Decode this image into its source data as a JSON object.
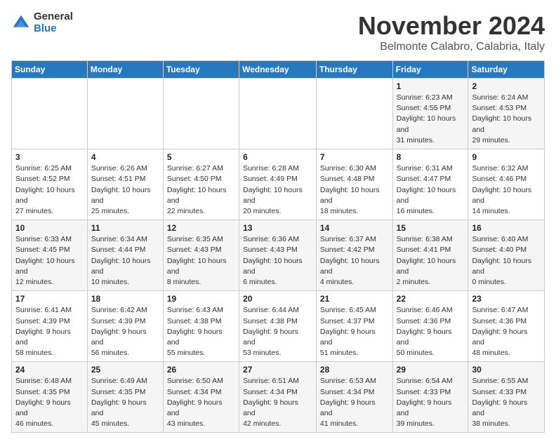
{
  "header": {
    "logo_general": "General",
    "logo_blue": "Blue",
    "month": "November 2024",
    "location": "Belmonte Calabro, Calabria, Italy"
  },
  "weekdays": [
    "Sunday",
    "Monday",
    "Tuesday",
    "Wednesday",
    "Thursday",
    "Friday",
    "Saturday"
  ],
  "weeks": [
    [
      {
        "day": "",
        "detail": ""
      },
      {
        "day": "",
        "detail": ""
      },
      {
        "day": "",
        "detail": ""
      },
      {
        "day": "",
        "detail": ""
      },
      {
        "day": "",
        "detail": ""
      },
      {
        "day": "1",
        "detail": "Sunrise: 6:23 AM\nSunset: 4:55 PM\nDaylight: 10 hours and 31 minutes."
      },
      {
        "day": "2",
        "detail": "Sunrise: 6:24 AM\nSunset: 4:53 PM\nDaylight: 10 hours and 29 minutes."
      }
    ],
    [
      {
        "day": "3",
        "detail": "Sunrise: 6:25 AM\nSunset: 4:52 PM\nDaylight: 10 hours and 27 minutes."
      },
      {
        "day": "4",
        "detail": "Sunrise: 6:26 AM\nSunset: 4:51 PM\nDaylight: 10 hours and 25 minutes."
      },
      {
        "day": "5",
        "detail": "Sunrise: 6:27 AM\nSunset: 4:50 PM\nDaylight: 10 hours and 22 minutes."
      },
      {
        "day": "6",
        "detail": "Sunrise: 6:28 AM\nSunset: 4:49 PM\nDaylight: 10 hours and 20 minutes."
      },
      {
        "day": "7",
        "detail": "Sunrise: 6:30 AM\nSunset: 4:48 PM\nDaylight: 10 hours and 18 minutes."
      },
      {
        "day": "8",
        "detail": "Sunrise: 6:31 AM\nSunset: 4:47 PM\nDaylight: 10 hours and 16 minutes."
      },
      {
        "day": "9",
        "detail": "Sunrise: 6:32 AM\nSunset: 4:46 PM\nDaylight: 10 hours and 14 minutes."
      }
    ],
    [
      {
        "day": "10",
        "detail": "Sunrise: 6:33 AM\nSunset: 4:45 PM\nDaylight: 10 hours and 12 minutes."
      },
      {
        "day": "11",
        "detail": "Sunrise: 6:34 AM\nSunset: 4:44 PM\nDaylight: 10 hours and 10 minutes."
      },
      {
        "day": "12",
        "detail": "Sunrise: 6:35 AM\nSunset: 4:43 PM\nDaylight: 10 hours and 8 minutes."
      },
      {
        "day": "13",
        "detail": "Sunrise: 6:36 AM\nSunset: 4:43 PM\nDaylight: 10 hours and 6 minutes."
      },
      {
        "day": "14",
        "detail": "Sunrise: 6:37 AM\nSunset: 4:42 PM\nDaylight: 10 hours and 4 minutes."
      },
      {
        "day": "15",
        "detail": "Sunrise: 6:38 AM\nSunset: 4:41 PM\nDaylight: 10 hours and 2 minutes."
      },
      {
        "day": "16",
        "detail": "Sunrise: 6:40 AM\nSunset: 4:40 PM\nDaylight: 10 hours and 0 minutes."
      }
    ],
    [
      {
        "day": "17",
        "detail": "Sunrise: 6:41 AM\nSunset: 4:39 PM\nDaylight: 9 hours and 58 minutes."
      },
      {
        "day": "18",
        "detail": "Sunrise: 6:42 AM\nSunset: 4:39 PM\nDaylight: 9 hours and 56 minutes."
      },
      {
        "day": "19",
        "detail": "Sunrise: 6:43 AM\nSunset: 4:38 PM\nDaylight: 9 hours and 55 minutes."
      },
      {
        "day": "20",
        "detail": "Sunrise: 6:44 AM\nSunset: 4:38 PM\nDaylight: 9 hours and 53 minutes."
      },
      {
        "day": "21",
        "detail": "Sunrise: 6:45 AM\nSunset: 4:37 PM\nDaylight: 9 hours and 51 minutes."
      },
      {
        "day": "22",
        "detail": "Sunrise: 6:46 AM\nSunset: 4:36 PM\nDaylight: 9 hours and 50 minutes."
      },
      {
        "day": "23",
        "detail": "Sunrise: 6:47 AM\nSunset: 4:36 PM\nDaylight: 9 hours and 48 minutes."
      }
    ],
    [
      {
        "day": "24",
        "detail": "Sunrise: 6:48 AM\nSunset: 4:35 PM\nDaylight: 9 hours and 46 minutes."
      },
      {
        "day": "25",
        "detail": "Sunrise: 6:49 AM\nSunset: 4:35 PM\nDaylight: 9 hours and 45 minutes."
      },
      {
        "day": "26",
        "detail": "Sunrise: 6:50 AM\nSunset: 4:34 PM\nDaylight: 9 hours and 43 minutes."
      },
      {
        "day": "27",
        "detail": "Sunrise: 6:51 AM\nSunset: 4:34 PM\nDaylight: 9 hours and 42 minutes."
      },
      {
        "day": "28",
        "detail": "Sunrise: 6:53 AM\nSunset: 4:34 PM\nDaylight: 9 hours and 41 minutes."
      },
      {
        "day": "29",
        "detail": "Sunrise: 6:54 AM\nSunset: 4:33 PM\nDaylight: 9 hours and 39 minutes."
      },
      {
        "day": "30",
        "detail": "Sunrise: 6:55 AM\nSunset: 4:33 PM\nDaylight: 9 hours and 38 minutes."
      }
    ]
  ]
}
